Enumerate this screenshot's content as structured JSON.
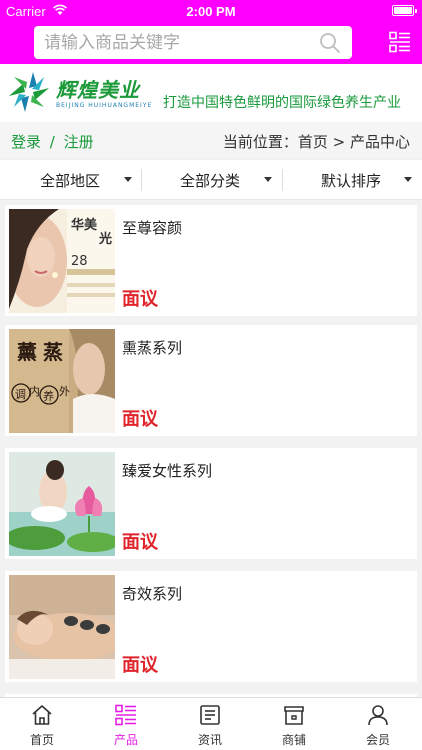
{
  "status_bar": {
    "carrier": "Carrier",
    "time": "2:00 PM",
    "battery_level": 1.0
  },
  "search": {
    "placeholder": "请输入商品关键字"
  },
  "brand": {
    "name_cn": "辉煌美业",
    "name_en": "BEIJING HUIHUANGMEIYE",
    "slogan": "打造中国特色鲜明的国际绿色养生产业"
  },
  "nav": {
    "login_link": "登录",
    "separator": "/",
    "register_link": "注册",
    "breadcrumb": "当前位置：首页 > 产品中心"
  },
  "filters": [
    {
      "label": "全部地区"
    },
    {
      "label": "全部分类"
    },
    {
      "label": "默认排序"
    }
  ],
  "products": [
    {
      "name": "至尊容颜",
      "price": "面议",
      "thumb_text": [
        "华美",
        "光",
        "28"
      ]
    },
    {
      "name": "熏蒸系列",
      "price": "面议",
      "thumb_text": [
        "薰",
        "蒸",
        "调",
        "内",
        "养",
        "外"
      ]
    },
    {
      "name": "臻爱女性系列",
      "price": "面议",
      "thumb_text": []
    },
    {
      "name": "奇效系列",
      "price": "面议",
      "thumb_text": []
    }
  ],
  "tabs": [
    {
      "label": "首页",
      "icon": "home-icon",
      "active": false
    },
    {
      "label": "产品",
      "icon": "list-icon",
      "active": true
    },
    {
      "label": "资讯",
      "icon": "news-icon",
      "active": false
    },
    {
      "label": "商铺",
      "icon": "store-icon",
      "active": false
    },
    {
      "label": "会员",
      "icon": "user-icon",
      "active": false
    }
  ],
  "colors": {
    "accent": "#ff00ff",
    "brand_green": "#1a9a3c",
    "price_red": "#e0242c",
    "tab_active": "#e51ee5"
  }
}
